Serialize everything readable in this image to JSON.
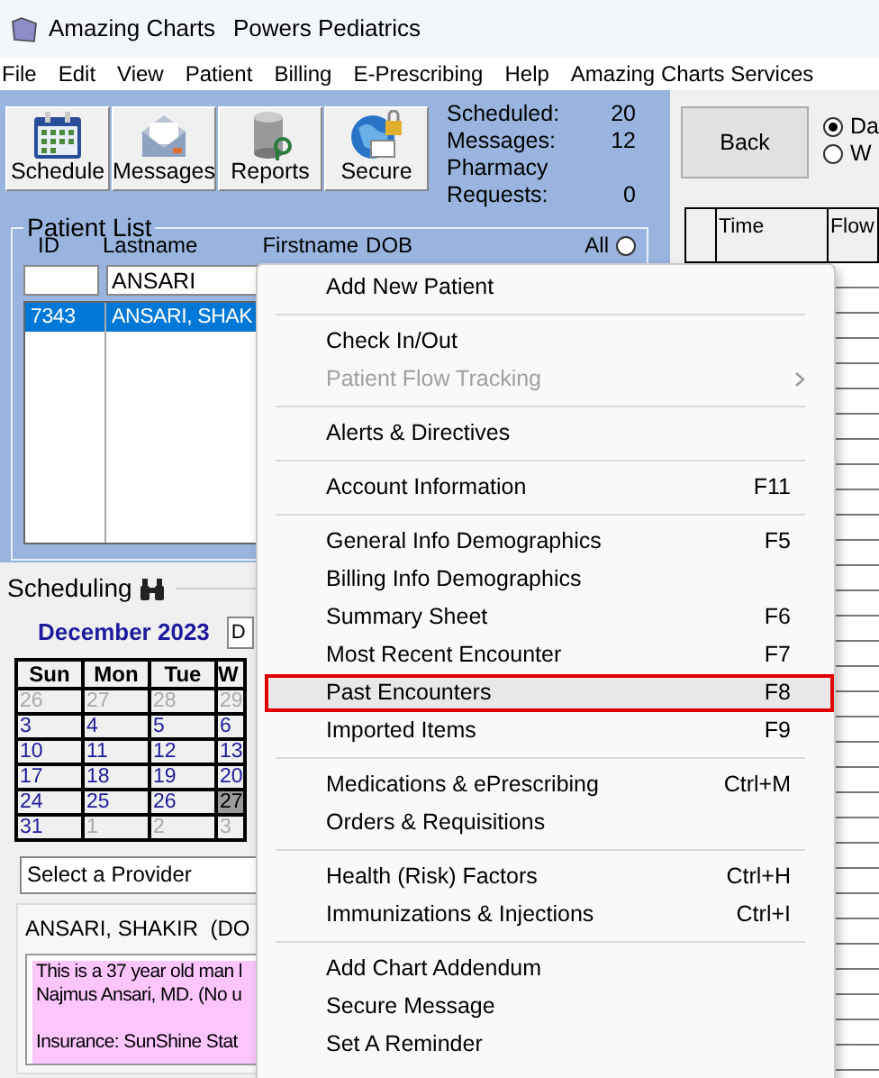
{
  "window": {
    "title": "Amazing Charts",
    "practice": "Powers Pediatrics"
  },
  "menu_bar": [
    "File",
    "Edit",
    "View",
    "Patient",
    "Billing",
    "E-Prescribing",
    "Help",
    "Amazing Charts Services"
  ],
  "toolbar": [
    {
      "label": "Schedule",
      "kind": "calendar"
    },
    {
      "label": "Messages",
      "kind": "envelope"
    },
    {
      "label": "Reports",
      "kind": "database"
    },
    {
      "label": "Secure",
      "kind": "globe"
    }
  ],
  "counts": [
    {
      "label": "Scheduled:",
      "value": "20"
    },
    {
      "label": "Messages:",
      "value": "12"
    },
    {
      "label": "Pharmacy Requests:",
      "value": "0"
    }
  ],
  "back_button": "Back",
  "view_options": [
    {
      "label": "Da",
      "selected": true
    },
    {
      "label": "W",
      "selected": false
    }
  ],
  "flow_grid": {
    "columns": [
      "Time",
      "Flow"
    ]
  },
  "patient_list": {
    "title": "Patient List",
    "columns": [
      "ID",
      "Lastname",
      "Firstname",
      "DOB"
    ],
    "all_option": {
      "label": "All",
      "selected": false
    },
    "lastname_filter": "ANSARI",
    "rows": [
      {
        "id": "7343",
        "name": "ANSARI, SHAK",
        "selected": true
      }
    ]
  },
  "scheduling": {
    "title": "Scheduling",
    "month": "December 2023",
    "month_select": "D",
    "weekdays": [
      "Sun",
      "Mon",
      "Tue",
      "W"
    ],
    "weeks": [
      [
        {
          "day": "26",
          "muted": true,
          "selected": false
        },
        {
          "day": "27",
          "muted": true,
          "selected": false
        },
        {
          "day": "28",
          "muted": true,
          "selected": false
        },
        {
          "day": "29",
          "muted": true,
          "selected": false
        }
      ],
      [
        {
          "day": "3",
          "muted": false,
          "selected": false
        },
        {
          "day": "4",
          "muted": false,
          "selected": false
        },
        {
          "day": "5",
          "muted": false,
          "selected": false
        },
        {
          "day": "6",
          "muted": false,
          "selected": false
        }
      ],
      [
        {
          "day": "10",
          "muted": false,
          "selected": false
        },
        {
          "day": "11",
          "muted": false,
          "selected": false
        },
        {
          "day": "12",
          "muted": false,
          "selected": false
        },
        {
          "day": "13",
          "muted": false,
          "selected": false
        }
      ],
      [
        {
          "day": "17",
          "muted": false,
          "selected": false
        },
        {
          "day": "18",
          "muted": false,
          "selected": false
        },
        {
          "day": "19",
          "muted": false,
          "selected": false
        },
        {
          "day": "20",
          "muted": false,
          "selected": false
        }
      ],
      [
        {
          "day": "24",
          "muted": false,
          "selected": false
        },
        {
          "day": "25",
          "muted": false,
          "selected": false
        },
        {
          "day": "26",
          "muted": false,
          "selected": false
        },
        {
          "day": "27",
          "muted": false,
          "selected": true
        }
      ],
      [
        {
          "day": "31",
          "muted": false,
          "selected": false
        },
        {
          "day": "1",
          "muted": true,
          "selected": false
        },
        {
          "day": "2",
          "muted": true,
          "selected": false
        },
        {
          "day": "3",
          "muted": true,
          "selected": false
        }
      ]
    ]
  },
  "provider_select": {
    "value": "Select a Provider"
  },
  "patient_summary": {
    "heading": "ANSARI, SHAKIR  (DO",
    "lines": [
      "This is a 37 year old man l",
      "Najmus Ansari, MD. (No u",
      "Insurance: SunShine Stat"
    ]
  },
  "context_menu": [
    {
      "kind": "item",
      "label": "Add New Patient",
      "selected": false,
      "disabled": false
    },
    {
      "kind": "separator"
    },
    {
      "kind": "item",
      "label": "Check In/Out",
      "selected": false,
      "disabled": false
    },
    {
      "kind": "item",
      "label": "Patient Flow Tracking",
      "selected": false,
      "disabled": true,
      "submenu": true
    },
    {
      "kind": "separator"
    },
    {
      "kind": "item",
      "label": "Alerts & Directives",
      "selected": false,
      "disabled": false
    },
    {
      "kind": "separator"
    },
    {
      "kind": "item",
      "label": "Account Information",
      "shortcut": "F11",
      "selected": false,
      "disabled": false
    },
    {
      "kind": "separator"
    },
    {
      "kind": "item",
      "label": "General Info Demographics",
      "shortcut": "F5",
      "selected": false,
      "disabled": false
    },
    {
      "kind": "item",
      "label": "Billing Info Demographics",
      "selected": false,
      "disabled": false
    },
    {
      "kind": "item",
      "label": "Summary Sheet",
      "shortcut": "F6",
      "selected": false,
      "disabled": false
    },
    {
      "kind": "item",
      "label": "Most Recent Encounter",
      "shortcut": "F7",
      "selected": false,
      "disabled": false
    },
    {
      "kind": "item",
      "label": "Past Encounters",
      "shortcut": "F8",
      "selected": true,
      "disabled": false
    },
    {
      "kind": "item",
      "label": "Imported Items",
      "shortcut": "F9",
      "selected": false,
      "disabled": false
    },
    {
      "kind": "separator"
    },
    {
      "kind": "item",
      "label": "Medications & ePrescribing",
      "shortcut": "Ctrl+M",
      "selected": false,
      "disabled": false
    },
    {
      "kind": "item",
      "label": "Orders & Requisitions",
      "selected": false,
      "disabled": false
    },
    {
      "kind": "separator"
    },
    {
      "kind": "item",
      "label": "Health (Risk) Factors",
      "shortcut": "Ctrl+H",
      "selected": false,
      "disabled": false
    },
    {
      "kind": "item",
      "label": "Immunizations & Injections",
      "shortcut": "Ctrl+I",
      "selected": false,
      "disabled": false
    },
    {
      "kind": "separator"
    },
    {
      "kind": "item",
      "label": "Add Chart Addendum",
      "selected": false,
      "disabled": false
    },
    {
      "kind": "item",
      "label": "Secure Message",
      "selected": false,
      "disabled": false
    },
    {
      "kind": "item",
      "label": "Set A Reminder",
      "selected": false,
      "disabled": false
    }
  ]
}
